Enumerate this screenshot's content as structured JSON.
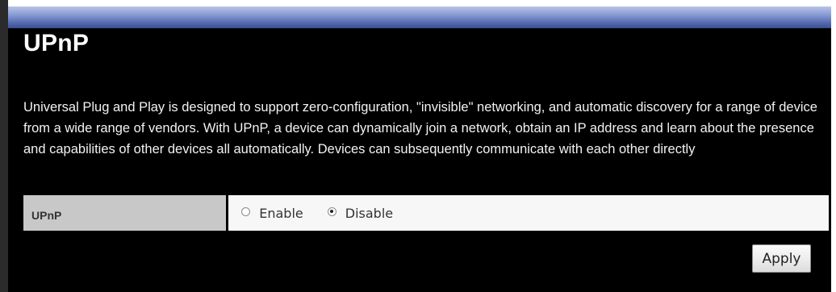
{
  "page": {
    "title": "UPnP",
    "description": "Universal Plug and Play is designed to support zero-configuration, \"invisible\" networking, and automatic discovery for a range of device from a wide range of vendors. With UPnP, a device can dynamically join a network, obtain an IP address and learn about the presence and capabilities of other devices all automatically. Devices can subsequently communicate with each other directly"
  },
  "setting": {
    "label": "UPnP",
    "options": [
      {
        "label": "Enable",
        "selected": false
      },
      {
        "label": "Disable",
        "selected": true
      }
    ]
  },
  "actions": {
    "apply_label": "Apply"
  },
  "colors": {
    "header_bar": "#5b70b6",
    "background": "#000000",
    "label_cell": "#c8c8c8",
    "value_cell": "#f7f7f7"
  }
}
